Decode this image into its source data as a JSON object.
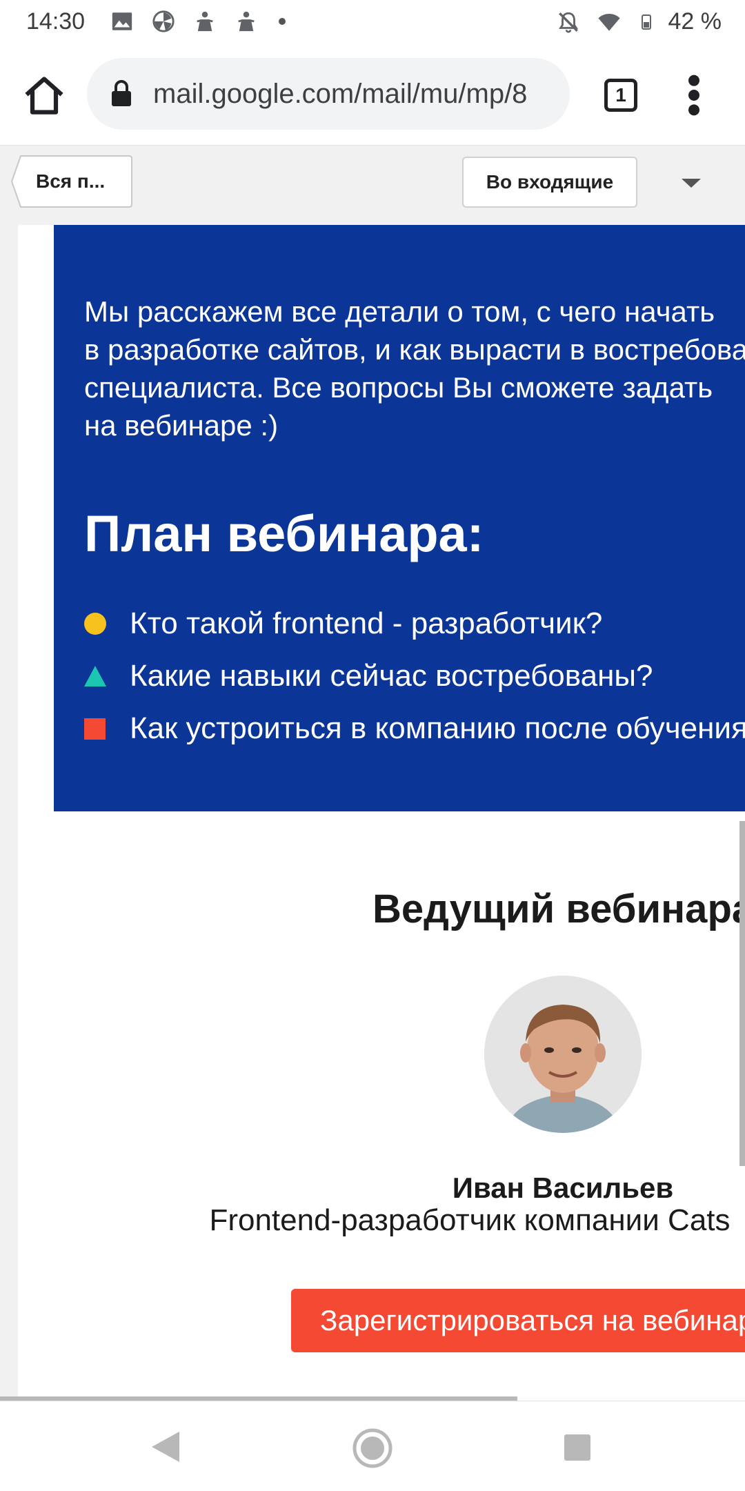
{
  "status_bar": {
    "time": "14:30",
    "battery_percent": "42 %",
    "icons": [
      "image-icon",
      "pinwheel-icon",
      "notification-figure-icon",
      "notification-figure-icon",
      "dot-icon",
      "bell-off-icon",
      "wifi-icon",
      "battery-icon"
    ]
  },
  "browser": {
    "url": "mail.google.com/mail/mu/mp/8",
    "tab_count": "1"
  },
  "gmail_nav": {
    "back_label": "Вся п...",
    "inbox_label": "Во входящие"
  },
  "email": {
    "intro_text": "Мы расскажем все детали о том, с чего начать\nв разработке сайтов, и как вырасти в востребованного\nспециалиста. Все вопросы Вы сможете задать\nна вебинаре :)",
    "plan_heading": "План вебинара:",
    "plan_items": [
      {
        "text": "Кто такой frontend - разработчик?",
        "bullet": "yellow-circle"
      },
      {
        "text": "Какие навыки сейчас востребованы?",
        "bullet": "teal-triangle"
      },
      {
        "text": "Как устроиться в компанию после обучения?",
        "bullet": "red-square"
      }
    ],
    "host_heading": "Ведущий вебинара:",
    "host_name": "Иван Васильев",
    "host_role": "Frontend-разработчик компании Cats",
    "register_button": "Зарегистрироваться на вебинар"
  },
  "colors": {
    "panel_blue": "#0b3697",
    "accent_red": "#f44a34",
    "bullet_yellow": "#f7c21d",
    "bullet_teal": "#1cc7b2"
  }
}
